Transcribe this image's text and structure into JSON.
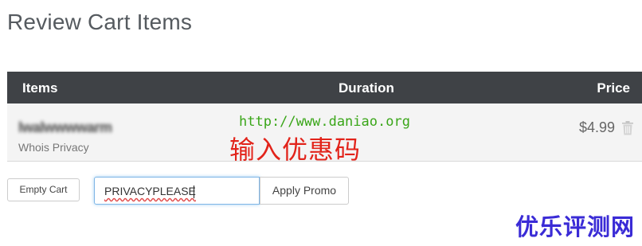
{
  "page": {
    "title": "Review Cart Items"
  },
  "cart": {
    "columns": {
      "items": "Items",
      "duration": "Duration",
      "price": "Price"
    },
    "rows": [
      {
        "domain": "lwalwwwwarm",
        "product": "Whois Privacy",
        "price": "$4.99",
        "remove_icon": "trash-icon"
      }
    ]
  },
  "actions": {
    "empty_cart_label": "Empty Cart",
    "promo_value": "PRIVACYPLEASE",
    "apply_promo_label": "Apply Promo"
  },
  "overlay": {
    "url_watermark": "http://www.daniao.org",
    "promo_hint": "输入优惠码",
    "site_watermark": "优乐评测网"
  },
  "colors": {
    "header_bg": "#3f4246",
    "row_bg": "#f4f4f4",
    "url_watermark": "#3aa619",
    "promo_hint": "#e2231a",
    "site_watermark": "#3a2bd6",
    "input_focus": "#7fb6e6"
  }
}
